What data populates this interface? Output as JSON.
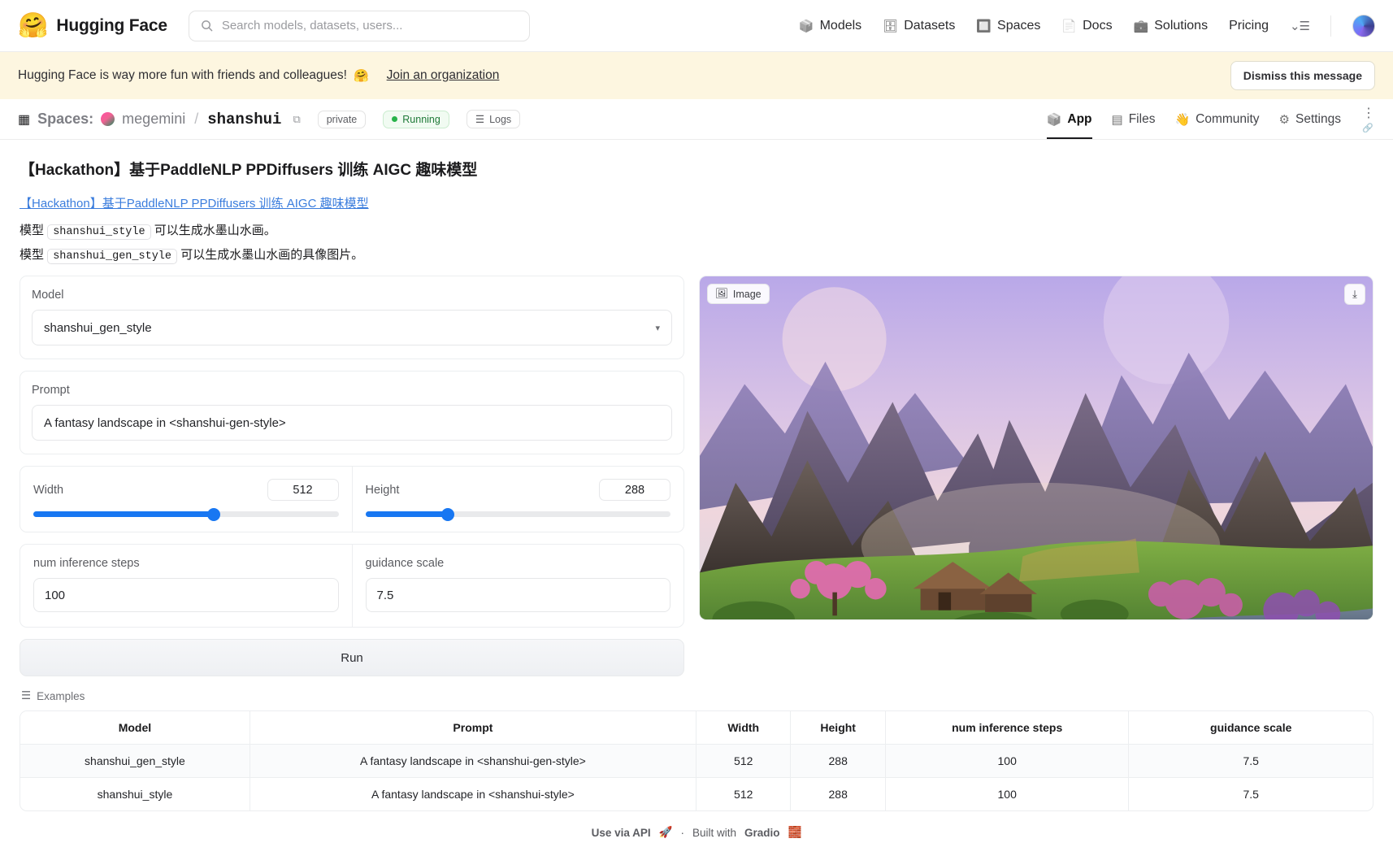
{
  "topbar": {
    "brand_name": "Hugging Face",
    "brand_logo": "🤗",
    "search": {
      "placeholder": "Search models, datasets, users...",
      "value": "",
      "icon": "search-icon"
    },
    "nav": [
      {
        "label": "Models",
        "icon": "📦"
      },
      {
        "label": "Datasets",
        "icon": "🗄"
      },
      {
        "label": "Spaces",
        "icon": "🔲"
      },
      {
        "label": "Docs",
        "icon": "📄"
      },
      {
        "label": "Solutions",
        "icon": "💼"
      },
      {
        "label": "Pricing",
        "icon": ""
      }
    ],
    "menu_icon": "⌄☰"
  },
  "banner": {
    "text": "Hugging Face is way more fun with friends and colleagues!",
    "emoji": "🤗",
    "link": "Join an organization",
    "dismiss": "Dismiss this message"
  },
  "space_header": {
    "grid_icon": "▦",
    "label": "Spaces:",
    "owner": "megemini",
    "slash": "/",
    "name": "shanshui",
    "copy_icon": "⧉",
    "visibility": "private",
    "status": "Running",
    "logs": "Logs",
    "tabs": [
      {
        "label": "App",
        "icon": "📦",
        "active": true
      },
      {
        "label": "Files",
        "icon": "▤",
        "active": false
      },
      {
        "label": "Community",
        "icon": "👋",
        "active": false
      },
      {
        "label": "Settings",
        "icon": "⚙",
        "active": false
      }
    ],
    "kebab": "⋮",
    "link_icon": "🔗"
  },
  "app": {
    "title": "【Hackathon】基于PaddleNLP PPDiffusers 训练 AIGC 趣味模型",
    "doc_link": "【Hackathon】基于PaddleNLP PPDiffusers 训练 AIGC 趣味模型",
    "desc": [
      {
        "pre": "模型",
        "code": "shanshui_style",
        "post": "可以生成水墨山水画。"
      },
      {
        "pre": "模型",
        "code": "shanshui_gen_style",
        "post": "可以生成水墨山水画的具像图片。"
      }
    ],
    "model": {
      "label": "Model",
      "value": "shanshui_gen_style",
      "caret": "▾"
    },
    "prompt": {
      "label": "Prompt",
      "value": "A fantasy landscape in <shanshui-gen-style>"
    },
    "width": {
      "label": "Width",
      "value": "512",
      "fill_percent": 59
    },
    "height": {
      "label": "Height",
      "value": "288",
      "fill_percent": 27
    },
    "steps": {
      "label": "num inference steps",
      "value": "100"
    },
    "guidance": {
      "label": "guidance scale",
      "value": "7.5"
    },
    "run_button": "Run",
    "image_panel": {
      "tag": "Image",
      "tag_icon": "🖼",
      "download_icon": "⤓"
    },
    "examples": {
      "label": "Examples",
      "icon": "☰",
      "columns": [
        "Model",
        "Prompt",
        "Width",
        "Height",
        "num inference steps",
        "guidance scale"
      ],
      "rows": [
        [
          "shanshui_gen_style",
          "A fantasy landscape in <shanshui-gen-style>",
          "512",
          "288",
          "100",
          "7.5"
        ],
        [
          "shanshui_style",
          "A fantasy landscape in <shanshui-style>",
          "512",
          "288",
          "100",
          "7.5"
        ]
      ]
    },
    "footer": {
      "api": "Use via API",
      "api_icon": "🚀",
      "dot": "·",
      "built_pre": "Built with",
      "built_brand": "Gradio",
      "built_icon": "🧱"
    }
  },
  "colors": {
    "accent": "#1877f2",
    "link": "#3b7ddd",
    "running": "#1f7a38",
    "banner_bg": "#fdf6e0"
  }
}
